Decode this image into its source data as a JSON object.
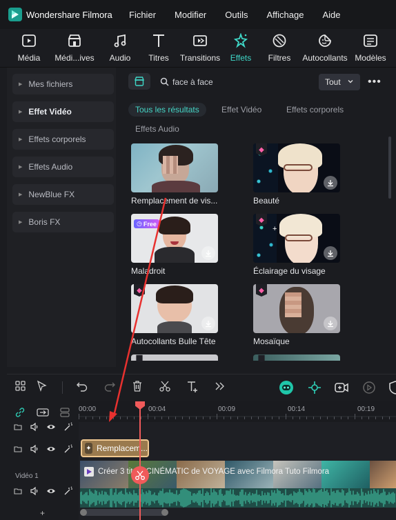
{
  "app": {
    "title": "Wondershare Filmora"
  },
  "menu": [
    "Fichier",
    "Modifier",
    "Outils",
    "Affichage",
    "Aide"
  ],
  "toolbar": {
    "items": [
      {
        "label": "Média",
        "icon": "media-icon"
      },
      {
        "label": "Médi...ives",
        "icon": "stock-media-icon"
      },
      {
        "label": "Audio",
        "icon": "music-note-icon"
      },
      {
        "label": "Titres",
        "icon": "text-t-icon"
      },
      {
        "label": "Transitions",
        "icon": "transitions-icon"
      },
      {
        "label": "Effets",
        "icon": "effects-sparkle-icon",
        "active": true
      },
      {
        "label": "Filtres",
        "icon": "filters-icon"
      },
      {
        "label": "Autocollants",
        "icon": "stickers-icon"
      },
      {
        "label": "Modèles",
        "icon": "templates-icon"
      }
    ]
  },
  "sidebar": {
    "items": [
      {
        "label": "Mes fichiers",
        "bold": false
      },
      {
        "label": "Effet Vidéo",
        "bold": true
      },
      {
        "label": "Effets corporels",
        "bold": false
      },
      {
        "label": "Effets Audio",
        "bold": false
      },
      {
        "label": "NewBlue FX",
        "bold": false
      },
      {
        "label": "Boris FX",
        "bold": false
      }
    ]
  },
  "search": {
    "value": "face à face",
    "filter": "Tout"
  },
  "chips": [
    "Tous les résultats",
    "Effet Vidéo",
    "Effets corporels",
    "Effets Audio"
  ],
  "results": [
    {
      "name": "Remplacement de vis...",
      "badge": "",
      "download": false
    },
    {
      "name": "Beauté",
      "badge": "gem",
      "download": true
    },
    {
      "name": "Maladroit",
      "badge": "Free",
      "download": true
    },
    {
      "name": "Éclairage du visage",
      "badge": "gem",
      "download": true
    },
    {
      "name": "Autocollants Bulle Tête",
      "badge": "gem",
      "download": true
    },
    {
      "name": "Mosaïque",
      "badge": "gem",
      "download": true
    }
  ],
  "timeline": {
    "ticks": [
      "00:00",
      "00:04",
      "00:09",
      "00:14",
      "00:19"
    ],
    "effect_clip": "Remplacem...",
    "video_clip_title": "Créer 3 titres CINÉMATIC de VOYAGE avec Filmora  Tuto Filmora",
    "track_label": "Vidéo 1",
    "add": "+"
  },
  "colors": {
    "accent": "#3fd8c8",
    "playhead": "#f05a5a",
    "effect_clip": "#9a7a4e"
  }
}
